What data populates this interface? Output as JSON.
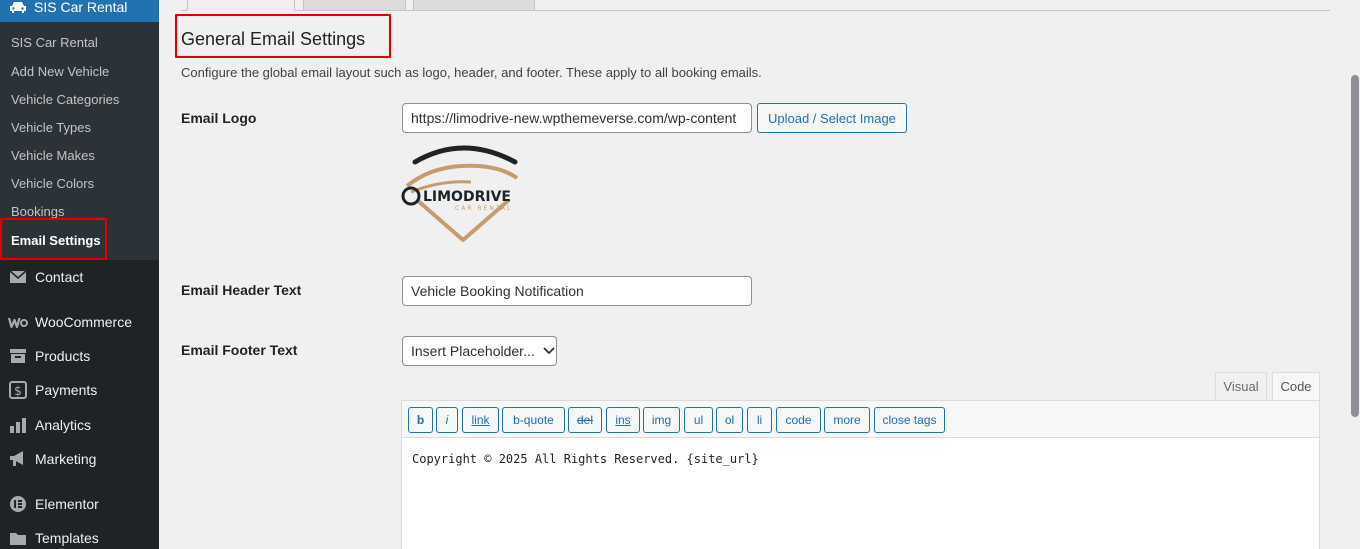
{
  "sidebar": {
    "top_active": {
      "label": "SIS Car Rental",
      "icon": "car-icon"
    },
    "submenu": [
      {
        "label": "SIS Car Rental"
      },
      {
        "label": "Add New Vehicle"
      },
      {
        "label": "Vehicle Categories"
      },
      {
        "label": "Vehicle Types"
      },
      {
        "label": "Vehicle Makes"
      },
      {
        "label": "Vehicle Colors"
      },
      {
        "label": "Bookings"
      },
      {
        "label": "Email Settings"
      }
    ],
    "items": [
      {
        "label": "Contact",
        "icon": "mail-icon"
      },
      {
        "label": "WooCommerce",
        "icon": "woocommerce-icon"
      },
      {
        "label": "Products",
        "icon": "archive-icon"
      },
      {
        "label": "Payments",
        "icon": "dollar-icon"
      },
      {
        "label": "Analytics",
        "icon": "bar-chart-icon"
      },
      {
        "label": "Marketing",
        "icon": "megaphone-icon"
      },
      {
        "label": "Elementor",
        "icon": "elementor-icon"
      },
      {
        "label": "Templates",
        "icon": "folder-icon"
      }
    ]
  },
  "page": {
    "title": "General Email Settings",
    "description": "Configure the global email layout such as logo, header, and footer. These apply to all booking emails."
  },
  "logo_row": {
    "label": "Email Logo",
    "url_value": "https://limodrive-new.wpthemeverse.com/wp-content",
    "upload_label": "Upload / Select Image",
    "logo_title": "LIMODRIVE",
    "logo_subtitle": "CAR RENTAL"
  },
  "header_row": {
    "label": "Email Header Text",
    "value": "Vehicle Booking Notification"
  },
  "footer_row": {
    "label": "Email Footer Text",
    "placeholder_select": "Insert Placeholder..."
  },
  "editor": {
    "tabs": {
      "visual": "Visual",
      "code": "Code"
    },
    "buttons": [
      "b",
      "i",
      "link",
      "b-quote",
      "del",
      "ins",
      "img",
      "ul",
      "ol",
      "li",
      "code",
      "more",
      "close tags"
    ],
    "content": "Copyright © 2025 All Rights Reserved. {site_url}"
  },
  "colors": {
    "sidebar_bg": "#1d2327",
    "submenu_bg": "#2c3338",
    "accent": "#2271b1",
    "highlight_box": "#e00000",
    "logo_gold": "#c69b6d"
  }
}
